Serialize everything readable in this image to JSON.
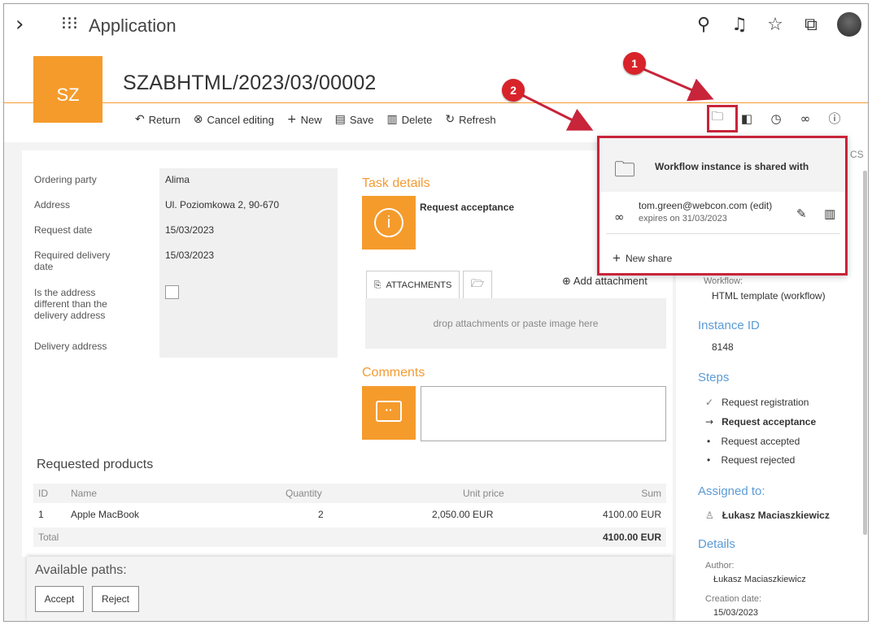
{
  "app": {
    "title": "Application"
  },
  "header": {
    "avatar_text": "SZ",
    "doc_title": "SZABHTML/2023/03/00002"
  },
  "toolbar": {
    "return": "Return",
    "cancel_editing": "Cancel editing",
    "new": "New",
    "save": "Save",
    "delete": "Delete",
    "refresh": "Refresh"
  },
  "form": {
    "ordering_party_label": "Ordering party",
    "ordering_party_value": "Alima",
    "address_label": "Address",
    "address_value": "Ul. Poziomkowa 2, 90-670",
    "request_date_label": "Request date",
    "request_date_value": "15/03/2023",
    "required_delivery_label": "Required delivery date",
    "required_delivery_value": "15/03/2023",
    "different_address_label": "Is the address different than the delivery address",
    "delivery_address_label": "Delivery address"
  },
  "task": {
    "title": "Task details",
    "name": "Request acceptance"
  },
  "attachments": {
    "tab_label": "ATTACHMENTS",
    "add_label": "Add attachment",
    "drop_text": "drop attachments or paste image here"
  },
  "comments": {
    "title": "Comments"
  },
  "products": {
    "title": "Requested products",
    "columns": [
      "ID",
      "Name",
      "Quantity",
      "Unit price",
      "Sum"
    ],
    "rows": [
      {
        "id": "1",
        "name": "Apple MacBook",
        "quantity": "2",
        "unit_price": "2,050.00 EUR",
        "sum": "4100.00 EUR"
      }
    ],
    "total_label": "Total",
    "total_value": "4100.00 EUR"
  },
  "paths": {
    "title": "Available paths:",
    "accept": "Accept",
    "reject": "Reject"
  },
  "sidebar": {
    "cs_text": "CS",
    "workflow_label": "Workflow:",
    "workflow_value": "HTML template (workflow)",
    "instance_title": "Instance ID",
    "instance_value": "8148",
    "steps_title": "Steps",
    "steps": [
      "Request registration",
      "Request acceptance",
      "Request accepted",
      "Request rejected"
    ],
    "assigned_title": "Assigned to:",
    "assigned_value": "Łukasz Maciaszkiewicz",
    "details_title": "Details",
    "author_label": "Author:",
    "author_value": "Łukasz Maciaszkiewicz",
    "creation_label": "Creation date:",
    "creation_value": "15/03/2023"
  },
  "share_popup": {
    "title": "Workflow instance is shared with",
    "email": "tom.green@webcon.com (edit)",
    "expires": "expires on 31/03/2023",
    "new_share": "New share"
  },
  "badges": {
    "one": "1",
    "two": "2"
  },
  "colors": {
    "accent_orange": "#f59b2c",
    "highlight_red": "#c8243a",
    "link_blue": "#5b9bd5"
  }
}
